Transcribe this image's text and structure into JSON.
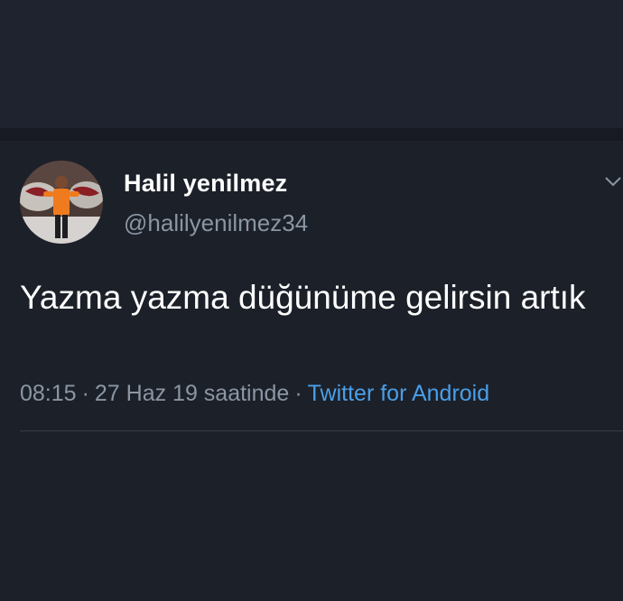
{
  "tweet": {
    "display_name": "Halil yenilmez",
    "handle": "@halilyenilmez34",
    "text": "Yazma yazma düğünüme gelirsin artık",
    "time": "08:15",
    "date_text": "27 Haz 19 saatinde",
    "separator": "·",
    "source": "Twitter for Android"
  },
  "icons": {
    "avatar": "avatar-photo",
    "menu": "chevron-down-icon"
  },
  "colors": {
    "background": "#1c2029",
    "text": "#ffffff",
    "secondary_text": "#8b96a3",
    "link": "#4a9fe8"
  }
}
